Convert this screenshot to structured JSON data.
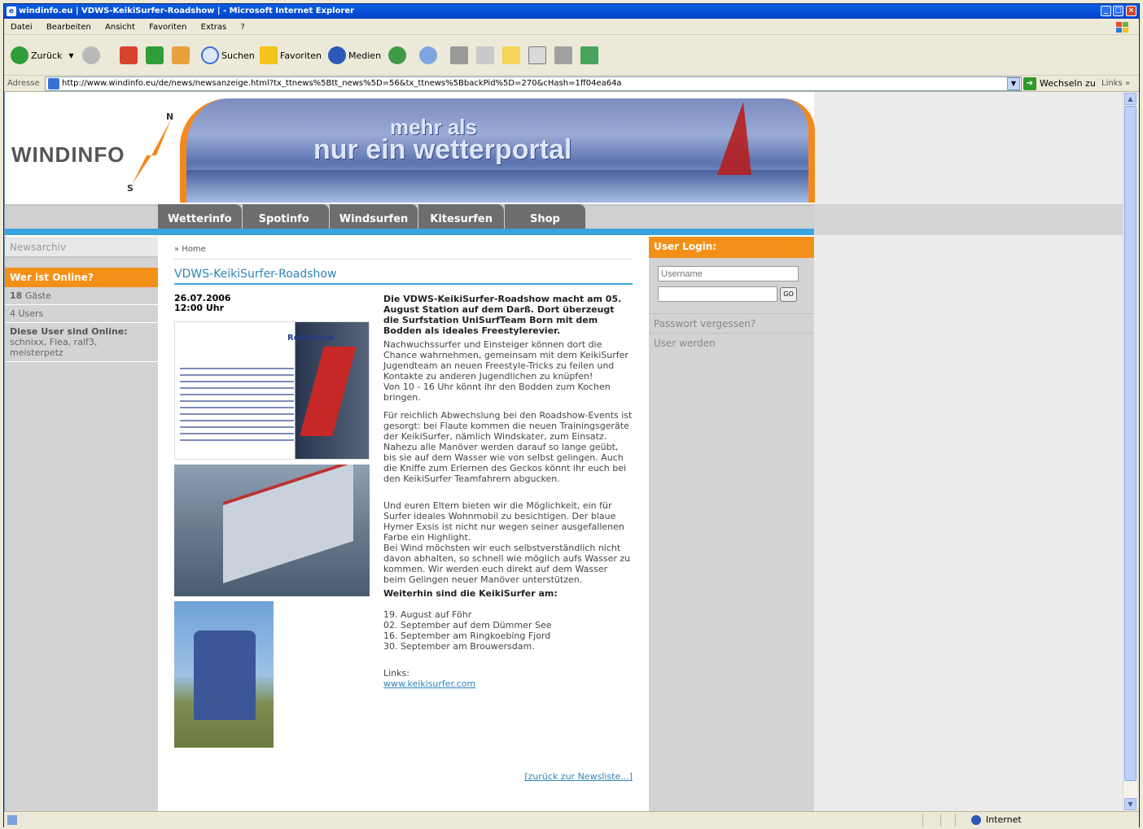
{
  "window": {
    "title": "windinfo.eu | VDWS-KeikiSurfer-Roadshow | - Microsoft Internet Explorer",
    "controls": [
      "_",
      "□",
      "×"
    ]
  },
  "menu": [
    "Datei",
    "Bearbeiten",
    "Ansicht",
    "Favoriten",
    "Extras",
    "?"
  ],
  "toolbar": {
    "back": "Zurück",
    "search": "Suchen",
    "favorites": "Favoriten",
    "media": "Medien"
  },
  "address": {
    "label": "Adresse",
    "url": "http://www.windinfo.eu/de/news/newsanzeige.html?tx_ttnews%5Btt_news%5D=56&tx_ttnews%5BbackPid%5D=270&cHash=1ff04ea64a",
    "go": "Wechseln zu",
    "links": "Links"
  },
  "status": {
    "zone": "Internet"
  },
  "site": {
    "logo": "WINDINFO",
    "compass_n": "N",
    "compass_s": "S",
    "slogan_line1": "mehr als",
    "slogan_line2": "nur ein wetterportal",
    "nav": [
      "Wetterinfo",
      "Spotinfo",
      "Windsurfen",
      "Kitesurfen",
      "Shop"
    ]
  },
  "left": {
    "newsarchiv": "Newsarchiv",
    "online_title": "Wer ist Online?",
    "guests_count": "18",
    "guests_label": "Gäste",
    "users": "4 Users",
    "online_users_title": "Diese User sind Online:",
    "online_users": "schnixx, Flea, ralf3, meisterpetz"
  },
  "article": {
    "breadcrumb": "» Home",
    "title": "VDWS-KeikiSurfer-Roadshow",
    "date": "26.07.2006",
    "time": "12:00 Uhr",
    "poster_title": "Roadshow",
    "lead": "Die VDWS-KeikiSurfer-Roadshow macht am 05. August Station auf dem Darß. Dort überzeugt die Surfstation UniSurfTeam Born mit dem Bodden als ideales Freestylerevier.",
    "p1": "Nachwuchssurfer und Einsteiger können dort die Chance wahrnehmen, gemeinsam mit dem KeikiSurfer Jugendteam an neuen Freestyle-Tricks zu feilen und Kontakte zu anderen Jugendlichen zu knüpfen!",
    "p1b": "Von 10 - 16 Uhr könnt ihr den Bodden zum Kochen bringen.",
    "p2": "Für reichlich Abwechslung bei den Roadshow-Events ist gesorgt: bei Flaute kommen die neuen Trainingsgeräte der KeikiSurfer, nämlich Windskater, zum Einsatz.",
    "p2b": "Nahezu alle Manöver werden darauf so lange geübt, bis sie auf dem Wasser wie von selbst gelingen. Auch die Kniffe zum Erlernen des Geckos könnt ihr euch bei den KeikiSurfer Teamfahrern abgucken.",
    "p3": "Und euren Eltern bieten wir die Möglichkeit, ein für Surfer ideales Wohnmobil zu besichtigen. Der blaue Hymer Exsis ist nicht nur wegen seiner ausgefallenen Farbe ein Highlight.",
    "p3b": "Bei Wind möchsten wir euch selbstverständlich nicht davon abhalten, so schnell wie möglich aufs Wasser zu kommen. Wir werden euch direkt auf dem Wasser beim Gelingen neuer Manöver unterstützen.",
    "dates_title": "Weiterhin sind die KeikiSurfer am:",
    "dates": [
      "19. August auf Föhr",
      "02. September auf dem Dümmer See",
      "16. September am Ringkoebing Fjord",
      "30. September am Brouwersdam."
    ],
    "links_label": "Links:",
    "link": "www.keikisurfer.com",
    "back": "[zurück zur Newsliste...]"
  },
  "right": {
    "login_title": "User Login:",
    "username_placeholder": "Username",
    "go": "GO",
    "forgot": "Passwort vergessen?",
    "register": "User werden"
  }
}
